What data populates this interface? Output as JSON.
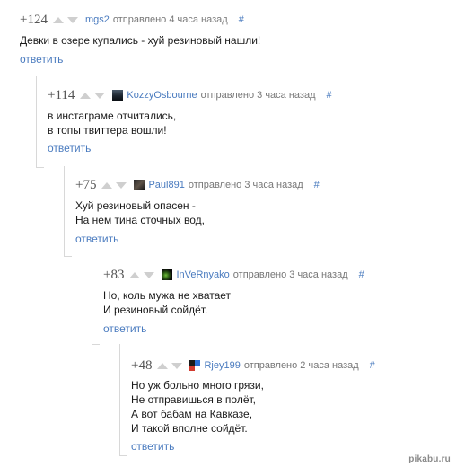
{
  "comments": [
    {
      "rating": "+124",
      "user": "mgs2",
      "sent": "отправлено 4 часа назад",
      "hash": "#",
      "lines": [
        "Девки в озере купались - хуй резиновый нашли!"
      ],
      "reply": "ответить"
    },
    {
      "rating": "+114",
      "user": "KozzyOsbourne",
      "sent": "отправлено 3 часа назад",
      "hash": "#",
      "lines": [
        "в инстаграме отчитались,",
        "в топы твиттера вошли!"
      ],
      "reply": "ответить"
    },
    {
      "rating": "+75",
      "user": "Paul891",
      "sent": "отправлено 3 часа назад",
      "hash": "#",
      "lines": [
        "Хуй резиновый опасен -",
        "На нем тина сточных вод,"
      ],
      "reply": "ответить"
    },
    {
      "rating": "+83",
      "user": "InVeRnyako",
      "sent": "отправлено 3 часа назад",
      "hash": "#",
      "lines": [
        "Но, коль мужа не хватает",
        "И резиновый сойдёт."
      ],
      "reply": "ответить"
    },
    {
      "rating": "+48",
      "user": "Rjey199",
      "sent": "отправлено 2 часа назад",
      "hash": "#",
      "lines": [
        "Но уж больно много грязи,",
        "Не отправишься в полёт,",
        "А вот бабам на Кавказе,",
        "И такой вполне сойдёт."
      ],
      "reply": "ответить"
    }
  ],
  "watermark": "pikabu.ru",
  "colors": {
    "link": "#4a7bbf",
    "arrow": "#cfcfcf",
    "border": "#d8d8d8"
  },
  "avatars": [
    "none",
    "dark-figure-avatar",
    "dark-photo-avatar",
    "green-on-black-avatar",
    "colorful-avatar"
  ]
}
